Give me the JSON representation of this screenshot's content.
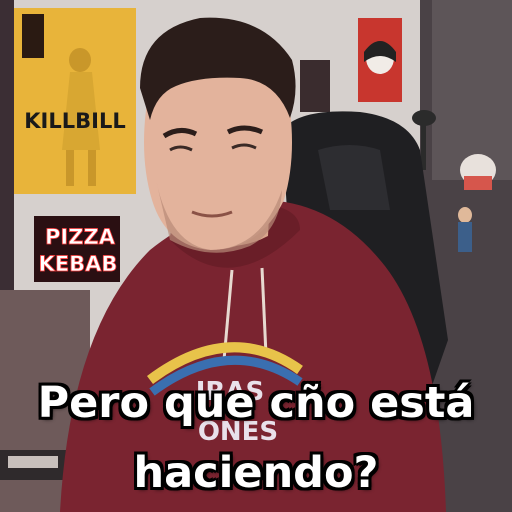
{
  "poster": {
    "title": "KILLBILL"
  },
  "neon_sign": {
    "line1": "PIZZA",
    "line2": "KEBAB"
  },
  "hoodie": {
    "print_line1": "IRAS",
    "print_line2": "ONES"
  },
  "caption": {
    "line1": "Pero que cño está",
    "line2": "haciendo?"
  },
  "colors": {
    "hoodie": "#7a2430",
    "poster": "#e8b43a",
    "neon": "#ff3a3a",
    "chair": "#1f1f22"
  }
}
